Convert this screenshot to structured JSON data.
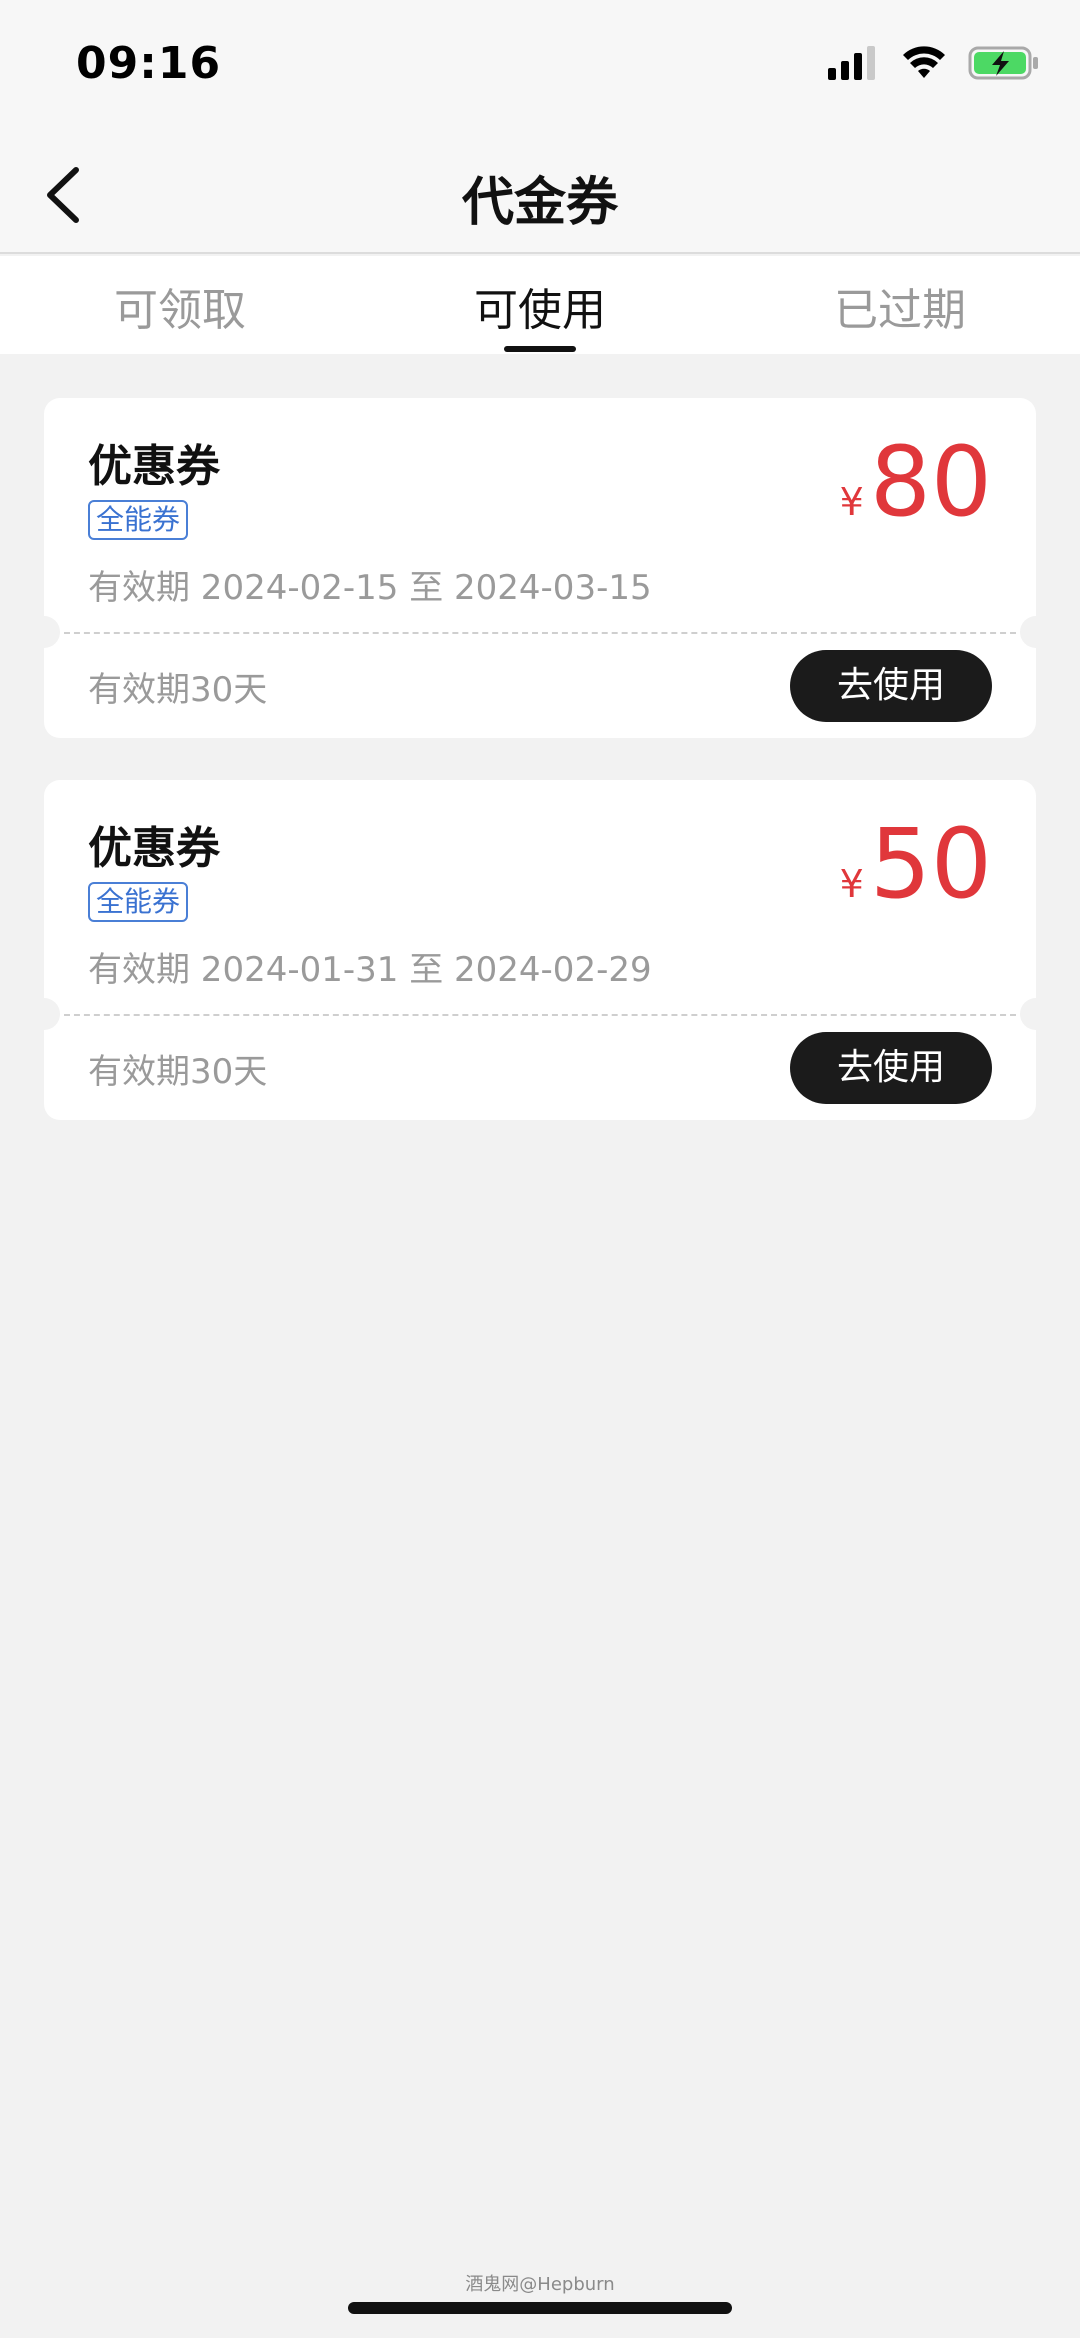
{
  "status_bar": {
    "time": "09:16",
    "icons": [
      "signal-icon",
      "wifi-icon",
      "battery-charging-icon"
    ],
    "battery_color": "#4cd964"
  },
  "header": {
    "title": "代金券",
    "back_icon": "chevron-left-icon"
  },
  "tabs": [
    {
      "label": "可领取",
      "active": false
    },
    {
      "label": "可使用",
      "active": true
    },
    {
      "label": "已过期",
      "active": false
    }
  ],
  "coupons": [
    {
      "title": "优惠券",
      "tag": "全能券",
      "validity": "有效期 2024-02-15 至 2024-03-15",
      "currency": "¥",
      "amount": "80",
      "period": "有效期30天",
      "button_label": "去使用"
    },
    {
      "title": "优惠券",
      "tag": "全能券",
      "validity": "有效期 2024-01-31 至 2024-02-29",
      "currency": "¥",
      "amount": "50",
      "period": "有效期30天",
      "button_label": "去使用"
    }
  ],
  "watermark": "酒鬼网@Hepburn",
  "colors": {
    "amount_red": "#e0373b",
    "tag_blue": "#3a72d1",
    "button_dark": "#1b1b1b"
  }
}
